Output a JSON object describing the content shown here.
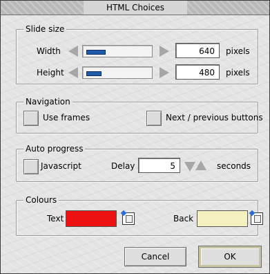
{
  "window": {
    "title": "HTML Choices"
  },
  "slide_size": {
    "label": "Slide size",
    "width": {
      "label": "Width",
      "value": "640",
      "unit": "pixels",
      "slider_fraction": 0.3
    },
    "height": {
      "label": "Height",
      "value": "480",
      "unit": "pixels",
      "slider_fraction": 0.23
    }
  },
  "navigation": {
    "label": "Navigation",
    "use_frames": {
      "label": "Use frames",
      "checked": false
    },
    "next_prev": {
      "label": "Next / previous buttons",
      "checked": false
    }
  },
  "auto_progress": {
    "label": "Auto progress",
    "javascript": {
      "label": "Javascript",
      "checked": false
    },
    "delay": {
      "label": "Delay",
      "value": "5",
      "unit": "seconds"
    }
  },
  "colours": {
    "label": "Colours",
    "text": {
      "label": "Text",
      "color": "#ee1111"
    },
    "back": {
      "label": "Back",
      "color": "#f5f1c0"
    }
  },
  "buttons": {
    "cancel": "Cancel",
    "ok": "OK"
  },
  "icons": {
    "slider_left": "arrow-left-icon",
    "slider_right": "arrow-right-icon",
    "spin_down": "arrow-down-icon",
    "spin_up": "arrow-up-icon",
    "colour_picker": "colour-picker-icon"
  }
}
